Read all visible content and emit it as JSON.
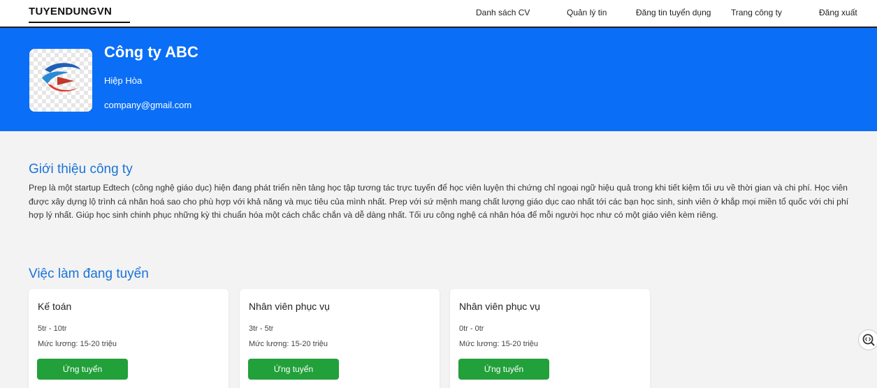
{
  "nav": {
    "brand": "TUYENDUNGVN",
    "items": [
      "Danh sách CV",
      "Quản lý tin",
      "Đăng tin tuyển dụng",
      "Trang công ty",
      "Đăng xuất"
    ]
  },
  "company": {
    "name": "Công ty ABC",
    "location": "Hiệp Hòa",
    "email": "company@gmail.com"
  },
  "intro": {
    "title": "Giới thiệu công ty",
    "text": "Prep là một startup Edtech (công nghệ giáo dục) hiện đang phát triển nền tảng học tập tương tác trực tuyến để học viên luyện thi chứng chỉ ngoại ngữ hiệu quả trong khi tiết kiệm tối ưu về thời gian và chi phí. Học viên được xây dựng lộ trình cá nhân hoá sao cho phù hợp với khả năng và mục tiêu của mình nhất. Prep với sứ mệnh mang chất lượng giáo dục cao nhất tới các bạn học sinh, sinh viên ở khắp mọi miền tổ quốc với chi phí hợp lý nhất. Giúp học sinh chinh phục những kỳ thi chuẩn hóa một cách chắc chắn và dễ dàng nhất. Tối ưu công nghệ cá nhân hóa để mỗi người học như có một giáo viên kèm riêng."
  },
  "jobs": {
    "title": "Việc làm đang tuyển",
    "items": [
      {
        "title": "Kế toán",
        "range": "5tr - 10tr",
        "salary": "Mức lương: 15-20 triệu",
        "button": "Ứng tuyển"
      },
      {
        "title": "Nhân viên phục vụ",
        "range": "3tr - 5tr",
        "salary": "Mức lương: 15-20 triệu",
        "button": "Ứng tuyển"
      },
      {
        "title": "Nhân viên phục vụ",
        "range": "0tr - 0tr",
        "salary": "Mức lương: 15-20 triệu",
        "button": "Ứng tuyển"
      }
    ]
  },
  "colors": {
    "banner": "#0a6ef7",
    "accent": "#1a73d9",
    "apply": "#22a03a"
  },
  "icons": {
    "logo": "company-logo-icon",
    "float": "search-code-icon"
  }
}
